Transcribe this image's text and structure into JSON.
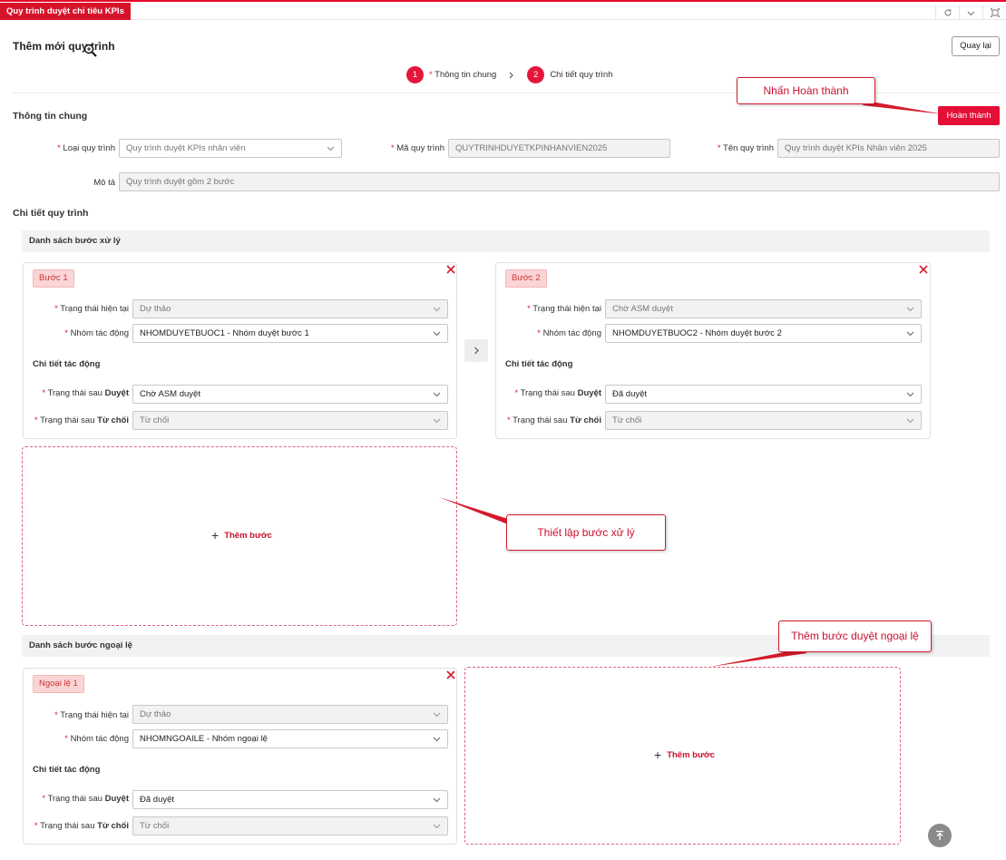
{
  "tabbar": {
    "active_tab": "Quy trình duyệt chỉ tiêu KPIs"
  },
  "header": {
    "title": "Thêm mới quy trình",
    "back_label": "Quay lại"
  },
  "steps": [
    {
      "number": "1",
      "label": "Thông tin chung"
    },
    {
      "number": "2",
      "label": "Chi tiết quy trình"
    }
  ],
  "general": {
    "section_title": "Thông tin chung",
    "done_label": "Hoàn thành",
    "type_label": "Loại quy trình",
    "type_value": "Quy trình duyệt KPIs nhân viên",
    "code_label": "Mã quy trình",
    "code_value": "QUYTRINHDUYETKPINHANVIEN2025",
    "name_label": "Tên quy trình",
    "name_value": "Quy trình duyệt KPIs Nhân viên 2025",
    "desc_label": "Mô tả",
    "desc_value": "Quy trình duyệt gồm 2 bước"
  },
  "detail": {
    "section_title": "Chi tiết quy trình",
    "steps_list_title": "Danh sách bước xử lý",
    "exceptions_list_title": "Danh sách bước ngoại lệ",
    "add_step_label": "Thêm bước"
  },
  "labels": {
    "current_status": "Trạng thái hiện tại",
    "action_group": "Nhóm tác động",
    "action_detail": "Chi tiết tác động",
    "after_prefix": "Trạng thái sau",
    "approve_word": "Duyệt",
    "reject_word": "Từ chối"
  },
  "step_cards": [
    {
      "badge": "Bước 1",
      "current_status": "Dự thảo",
      "action_group": "NHOMDUYETBUOC1 - Nhóm duyệt bước 1",
      "after_approve": "Chờ ASM duyệt",
      "after_reject": "Từ chối"
    },
    {
      "badge": "Bước 2",
      "current_status": "Chờ ASM duyệt",
      "action_group": "NHOMDUYETBUOC2 - Nhóm duyệt bước 2",
      "after_approve": "Đã duyệt",
      "after_reject": "Từ chối"
    }
  ],
  "exception_cards": [
    {
      "badge": "Ngoại lệ 1",
      "current_status": "Dự thảo",
      "action_group": "NHOMNGOAILE - Nhóm ngoại lệ",
      "after_approve": "Đã duyệt",
      "after_reject": "Từ chối"
    }
  ],
  "callouts": {
    "done": "Nhấn Hoàn thành",
    "setup": "Thiết lập bước xử lý",
    "exception": "Thêm bước duyệt ngoại lệ"
  },
  "colors": {
    "accent": "#e30f37",
    "badge_bg": "#fbd5d5",
    "callout_border": "#d51b2c"
  },
  "icons": [
    "refresh-icon",
    "chevron-down-icon",
    "maximize-icon",
    "chevron-right-icon",
    "close-icon",
    "plus-icon",
    "arrow-up-icon",
    "zoom-cursor-icon"
  ]
}
